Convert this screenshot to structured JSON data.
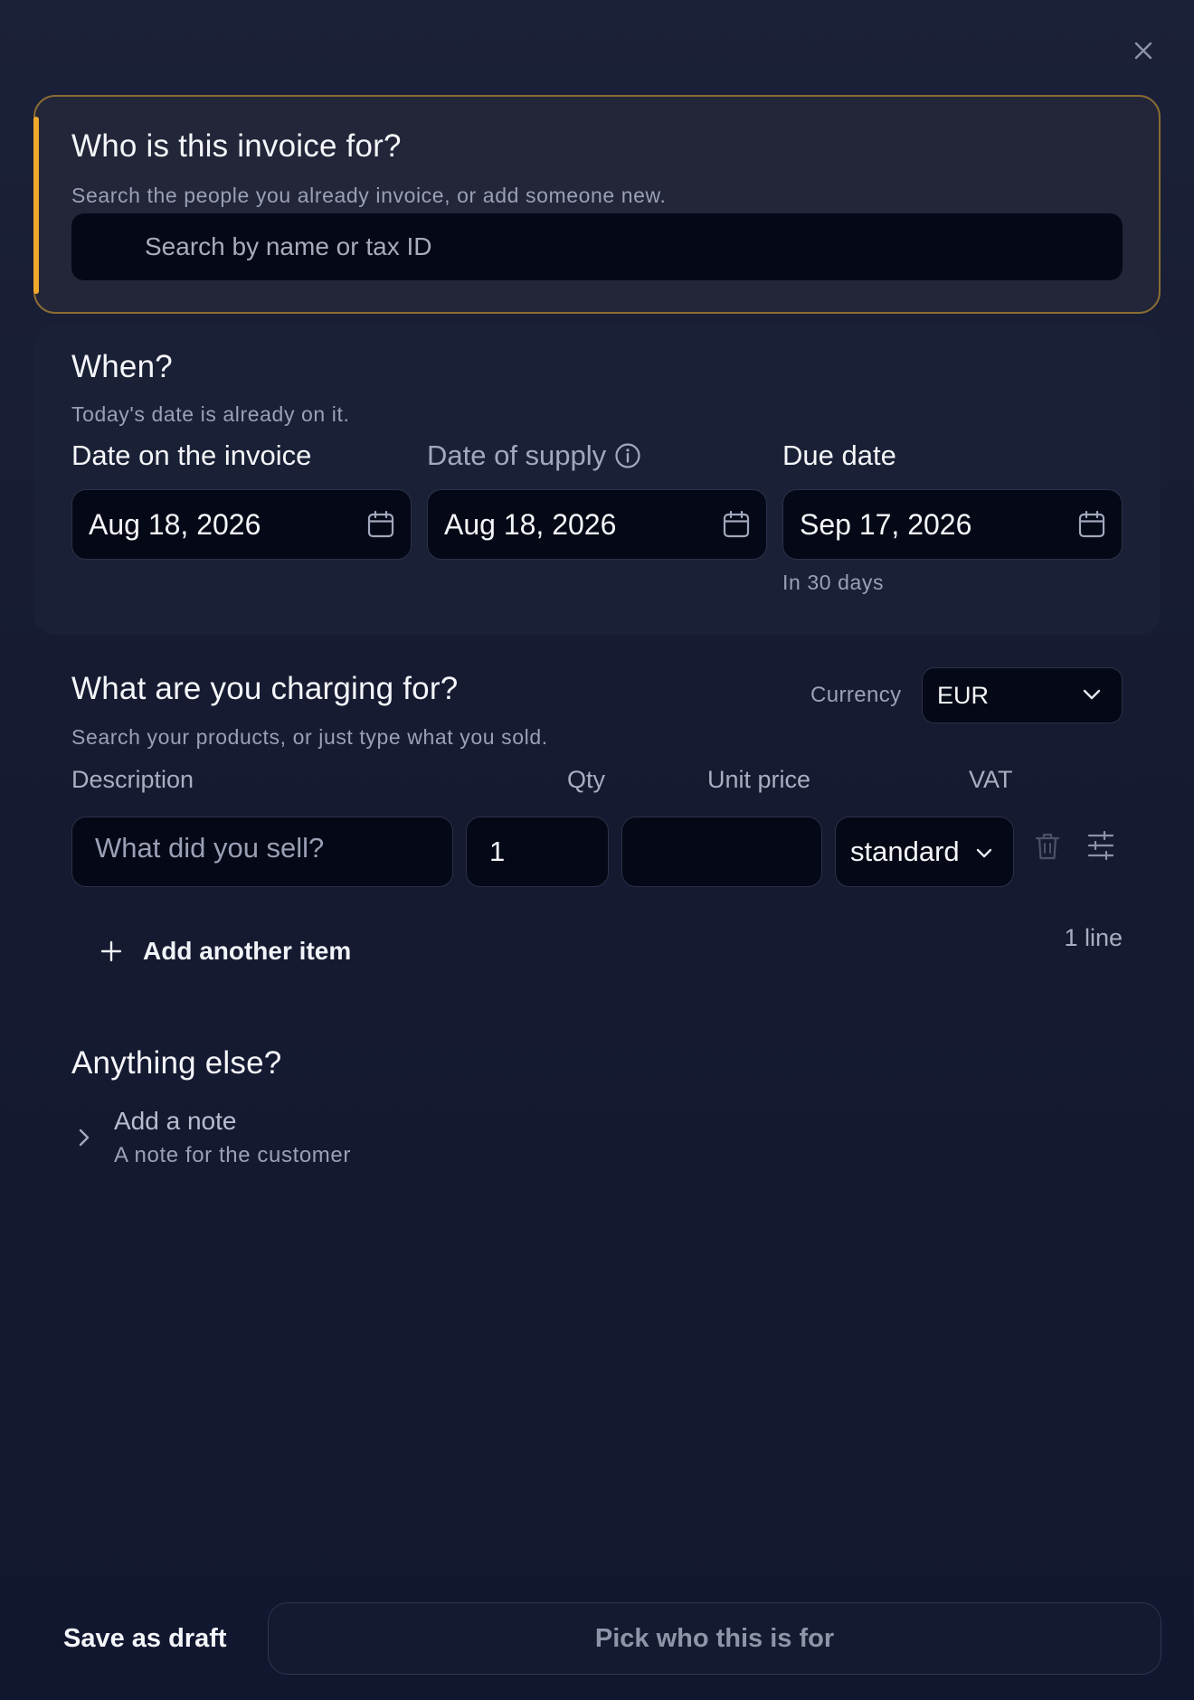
{
  "icons": {
    "close": "close-icon",
    "calendar": "calendar-icon",
    "info": "info-icon",
    "chevron_down": "chevron-down-icon",
    "trash": "trash-icon",
    "sliders": "sliders-icon",
    "plus": "plus-icon",
    "chevron_right": "chevron-right-icon"
  },
  "colors": {
    "accent": "#f0a92b",
    "background": "#161b31",
    "input_bg": "#050816"
  },
  "recipient": {
    "title": "Who is this invoice for?",
    "subtitle": "Search the people you already invoice, or add someone new.",
    "search_placeholder": "Search by name or tax ID",
    "search_value": ""
  },
  "when": {
    "title": "When?",
    "subtitle": "Today's date is already on it.",
    "invoice_date_label": "Date on the invoice",
    "invoice_date_value": "Aug 18, 2026",
    "supply_date_label": "Date of supply",
    "supply_date_value": "Aug 18, 2026",
    "due_date_label": "Due date",
    "due_date_value": "Sep 17, 2026",
    "due_hint": "In 30 days"
  },
  "items": {
    "title": "What are you charging for?",
    "subtitle": "Search your products, or just type what you sold.",
    "currency_label": "Currency",
    "currency_value": "EUR",
    "columns": {
      "description": "Description",
      "qty": "Qty",
      "unit_price": "Unit price",
      "vat": "VAT"
    },
    "row": {
      "description_placeholder": "What did you sell?",
      "description_value": "",
      "qty": "1",
      "unit_price": "",
      "vat": "standard"
    },
    "add_label": "Add another item",
    "count_label": "1 line"
  },
  "extra": {
    "title": "Anything else?",
    "note_title": "Add a note",
    "note_subtitle": "A note for the customer"
  },
  "footer": {
    "save_draft": "Save as draft",
    "primary": "Pick who this is for"
  }
}
